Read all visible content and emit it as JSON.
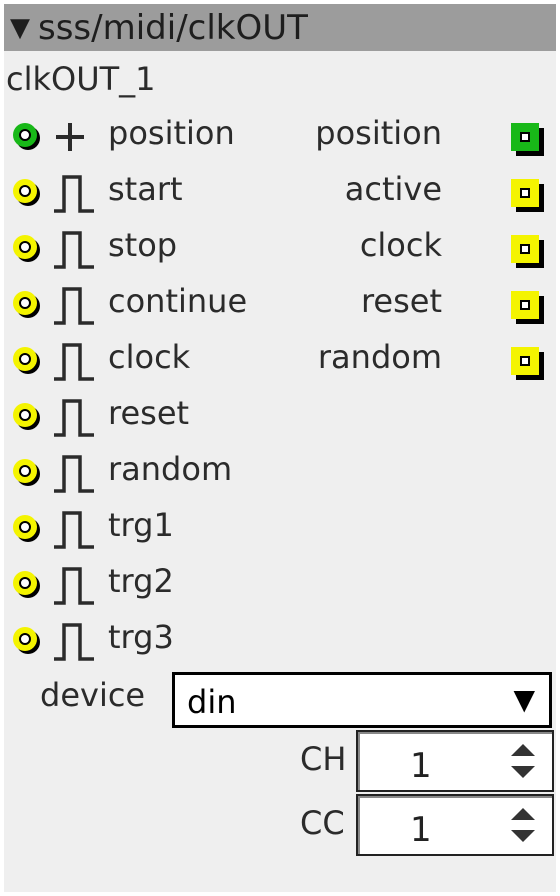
{
  "title": "sss/midi/clkOUT",
  "title_arrow": "▼",
  "instance_name": "clkOUT_1",
  "inputs": [
    {
      "label": "position",
      "type": "int",
      "icon": "plus-icon",
      "color": "#18b818"
    },
    {
      "label": "start",
      "type": "trigger",
      "icon": "pulse-icon",
      "color": "#f4f400"
    },
    {
      "label": "stop",
      "type": "trigger",
      "icon": "pulse-icon",
      "color": "#f4f400"
    },
    {
      "label": "continue",
      "type": "trigger",
      "icon": "pulse-icon",
      "color": "#f4f400"
    },
    {
      "label": "clock",
      "type": "trigger",
      "icon": "pulse-icon",
      "color": "#f4f400"
    },
    {
      "label": "reset",
      "type": "trigger",
      "icon": "pulse-icon",
      "color": "#f4f400"
    },
    {
      "label": "random",
      "type": "trigger",
      "icon": "pulse-icon",
      "color": "#f4f400"
    },
    {
      "label": "trg1",
      "type": "trigger",
      "icon": "pulse-icon",
      "color": "#f4f400"
    },
    {
      "label": "trg2",
      "type": "trigger",
      "icon": "pulse-icon",
      "color": "#f4f400"
    },
    {
      "label": "trg3",
      "type": "trigger",
      "icon": "pulse-icon",
      "color": "#f4f400"
    }
  ],
  "outputs": [
    {
      "label": "position",
      "color": "#18b818"
    },
    {
      "label": "active",
      "color": "#f4f400"
    },
    {
      "label": "clock",
      "color": "#f4f400"
    },
    {
      "label": "reset",
      "color": "#f4f400"
    },
    {
      "label": "random",
      "color": "#f4f400"
    }
  ],
  "device": {
    "label": "device",
    "value": "din",
    "arrow": "▼"
  },
  "ch": {
    "label": "CH",
    "value": "1"
  },
  "cc": {
    "label": "CC",
    "value": "1"
  }
}
